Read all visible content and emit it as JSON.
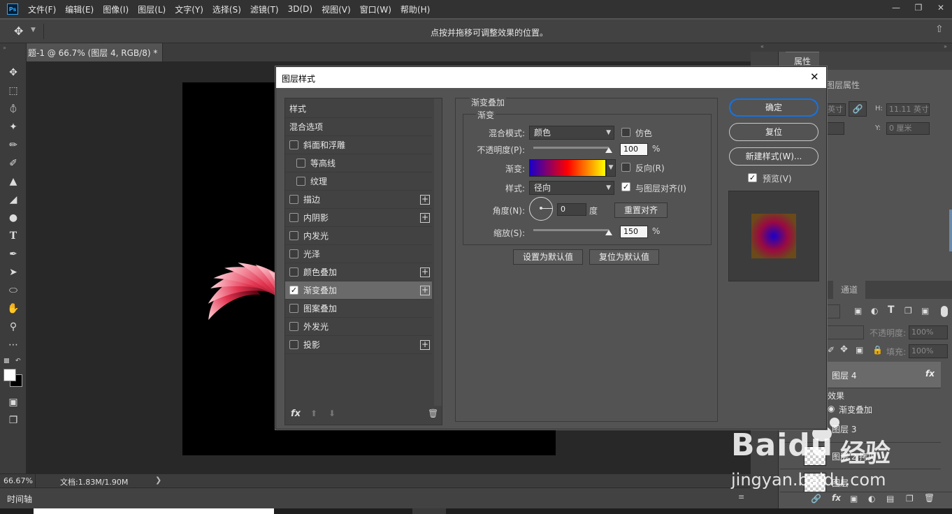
{
  "menubar": {
    "app_icon": "Ps",
    "items": [
      "文件(F)",
      "编辑(E)",
      "图像(I)",
      "图层(L)",
      "文字(Y)",
      "选择(S)",
      "滤镜(T)",
      "3D(D)",
      "视图(V)",
      "窗口(W)",
      "帮助(H)"
    ]
  },
  "optionsbar": {
    "hint": "点按并拖移可调整效果的位置。"
  },
  "document": {
    "tab_title": "题-1 @ 66.7% (图层 4, RGB/8) *",
    "zoom": "66.67%",
    "doc_info": "文档:1.83M/1.90M"
  },
  "timeline": {
    "label": "时间轴"
  },
  "properties": {
    "tab_label": "属性",
    "subtitle": "图层属性",
    "w_unit": "英寸",
    "h_label": "H:",
    "h_value": "11.11 英寸",
    "y_label": "Y:",
    "y_value": "0 厘米"
  },
  "layers": {
    "channels_tab": "通道",
    "opacity_label": "不透明度:",
    "opacity_value": "100%",
    "fill_label": "填充:",
    "fill_value": "100%",
    "items": [
      {
        "name": "图层 4",
        "fx": "fx"
      },
      {
        "name": "效果"
      },
      {
        "name": "渐变叠加"
      },
      {
        "name": "图层 3"
      },
      {
        "name": "图层 2 拷贝"
      },
      {
        "name": "图层"
      }
    ]
  },
  "dialog": {
    "title": "图层样式",
    "styles": [
      {
        "label": "样式",
        "checkbox": false
      },
      {
        "label": "混合选项",
        "checkbox": false
      },
      {
        "label": "斜面和浮雕",
        "checkbox": true,
        "checked": false
      },
      {
        "label": "等高线",
        "checkbox": true,
        "checked": false,
        "indent": true
      },
      {
        "label": "纹理",
        "checkbox": true,
        "checked": false,
        "indent": true
      },
      {
        "label": "描边",
        "checkbox": true,
        "checked": false,
        "plus": true
      },
      {
        "label": "内阴影",
        "checkbox": true,
        "checked": false,
        "plus": true
      },
      {
        "label": "内发光",
        "checkbox": true,
        "checked": false
      },
      {
        "label": "光泽",
        "checkbox": true,
        "checked": false
      },
      {
        "label": "颜色叠加",
        "checkbox": true,
        "checked": false,
        "plus": true
      },
      {
        "label": "渐变叠加",
        "checkbox": true,
        "checked": true,
        "plus": true,
        "active": true
      },
      {
        "label": "图案叠加",
        "checkbox": true,
        "checked": false
      },
      {
        "label": "外发光",
        "checkbox": true,
        "checked": false
      },
      {
        "label": "投影",
        "checkbox": true,
        "checked": false,
        "plus": true
      }
    ],
    "fx_label": "fx",
    "section_title": "渐变叠加",
    "group_title": "渐变",
    "blend_mode_label": "混合模式:",
    "blend_mode_value": "颜色",
    "dither_label": "仿色",
    "opacity_label": "不透明度(P):",
    "opacity_value": "100",
    "percent": "%",
    "gradient_label": "渐变:",
    "reverse_label": "反向(R)",
    "style_label": "样式:",
    "style_value": "径向",
    "align_label": "与图层对齐(I)",
    "angle_label": "角度(N):",
    "angle_value": "0",
    "degree_unit": "度",
    "reset_align_label": "重置对齐",
    "scale_label": "缩放(S):",
    "scale_value": "150",
    "set_default_label": "设置为默认值",
    "reset_default_label": "复位为默认值",
    "ok_label": "确定",
    "reset_label": "复位",
    "new_style_label": "新建样式(W)...",
    "preview_label": "预览(V)",
    "opacity_level": 1.0,
    "scale_level": 1.0
  },
  "watermark": {
    "brand": "Baidu",
    "brand_cn": "经验",
    "url": "jingyan.baidu.com"
  },
  "colors": {
    "accent_focus": "#1473e6",
    "gradient": [
      "#1a00c8",
      "#ff0000",
      "#ffff00"
    ]
  }
}
